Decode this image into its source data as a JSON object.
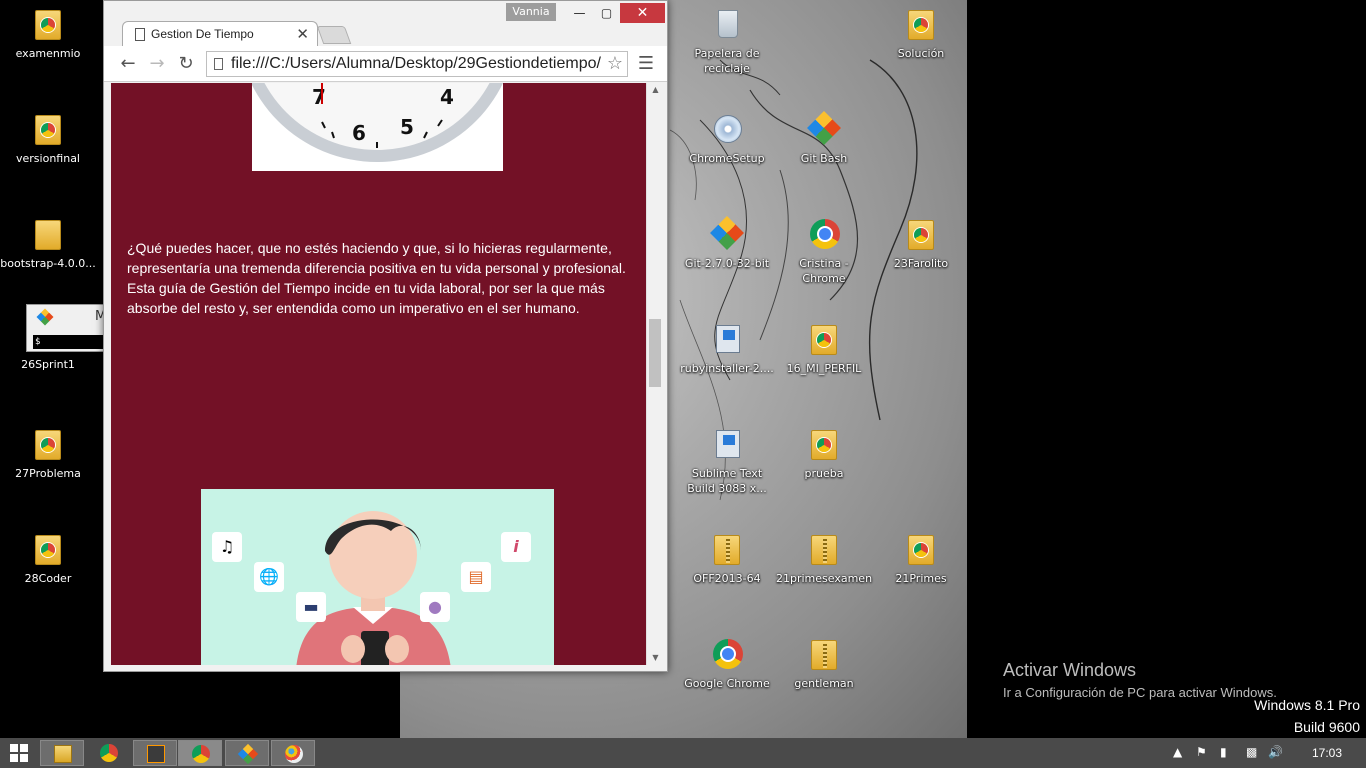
{
  "desktop_left": [
    {
      "label": "examenmio",
      "type": "chrome-folder"
    },
    {
      "label": "versionfinal",
      "type": "chrome-folder"
    },
    {
      "label": "bootstrap-4.0.0...",
      "type": "folder"
    },
    {
      "label": "26Sprint1",
      "type": "git-bash-window"
    },
    {
      "label": "27Problema",
      "type": "chrome-folder"
    },
    {
      "label": "28Coder",
      "type": "chrome-folder"
    }
  ],
  "mini_terminal": {
    "title_letter": "M",
    "prompt": "$"
  },
  "desktop_right": [
    {
      "label": "Papelera de reciclaje",
      "type": "recycle-bin"
    },
    {
      "label": "Solución",
      "type": "chrome-folder"
    },
    {
      "label": "ChromeSetup",
      "type": "cd"
    },
    {
      "label": "Git Bash",
      "type": "git"
    },
    {
      "label": "Git-2.7.0-32-bit",
      "type": "git"
    },
    {
      "label": "Cristina - Chrome",
      "type": "chrome"
    },
    {
      "label": "23Farolito",
      "type": "chrome-folder"
    },
    {
      "label": "rubyinstaller-2....",
      "type": "installer"
    },
    {
      "label": "16_MI_PERFIL",
      "type": "chrome-folder"
    },
    {
      "label": "Sublime Text Build 3083 x...",
      "type": "installer"
    },
    {
      "label": "prueba",
      "type": "chrome-folder"
    },
    {
      "label": "OFF2013-64",
      "type": "zip-folder"
    },
    {
      "label": "21primesexamen",
      "type": "zip-folder"
    },
    {
      "label": "21Primes",
      "type": "chrome-folder"
    },
    {
      "label": "Google Chrome",
      "type": "chrome"
    },
    {
      "label": "gentleman",
      "type": "zip-folder"
    }
  ],
  "browser": {
    "profile": "Vannia",
    "tab_title": "Gestion De Tiempo",
    "url": "file:///C:/Users/Alumna/Desktop/29Gestiondetiempo/",
    "scroll_fraction": 0.42
  },
  "page": {
    "bg_color": "#731126",
    "paragraph": "¿Qué puedes hacer, que no estés haciendo y que, si lo hicieras regularmente, representaría una tremenda diferencia positiva en tu vida personal y profesional. Esta guía de Gestión del Tiempo incide en tu vida laboral, por ser la que más absorbe del resto y, ser entendida como un imperativo en el ser humano.",
    "clock_numbers": [
      "4",
      "5",
      "6",
      "7"
    ],
    "illustration_icons": [
      "music-note-icon",
      "globe-icon",
      "car-icon",
      "info-icon",
      "cart-icon",
      "chat-icon"
    ]
  },
  "watermark": {
    "heading": "Activar Windows",
    "subtext": "Ir a Configuración de PC para activar Windows.",
    "version_line1": "Windows 8.1 Pro",
    "version_line2": "Build 9600"
  },
  "taskbar": {
    "time": "17:03",
    "apps": [
      "file-explorer",
      "chrome",
      "sublime-text",
      "chrome-profile",
      "git-bash",
      "paint"
    ],
    "active_index": 3
  }
}
